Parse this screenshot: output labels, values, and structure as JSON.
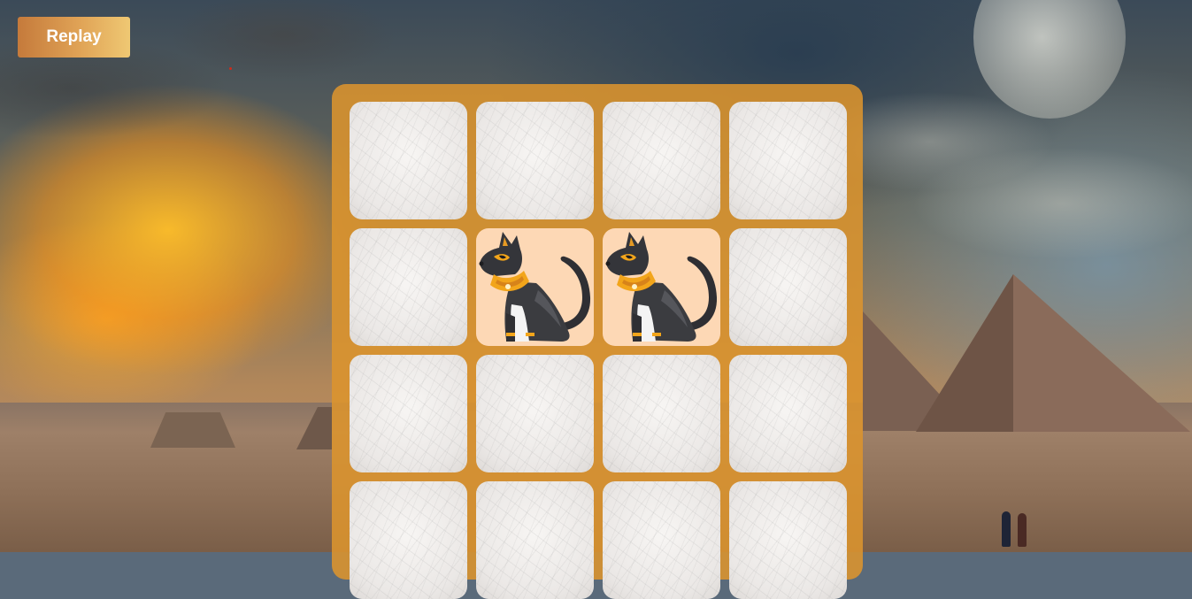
{
  "header": {
    "replay_label": "Replay"
  },
  "board": {
    "cards": [
      {
        "state": "face-down"
      },
      {
        "state": "face-down"
      },
      {
        "state": "face-down"
      },
      {
        "state": "face-down"
      },
      {
        "state": "face-down"
      },
      {
        "state": "face-up",
        "icon": "bastet-cat-icon"
      },
      {
        "state": "face-up",
        "icon": "bastet-cat-icon"
      },
      {
        "state": "face-down"
      },
      {
        "state": "face-down"
      },
      {
        "state": "face-down"
      },
      {
        "state": "face-down"
      },
      {
        "state": "face-down"
      },
      {
        "state": "face-down"
      },
      {
        "state": "face-down"
      },
      {
        "state": "face-down"
      },
      {
        "state": "face-down"
      }
    ]
  },
  "colors": {
    "board": "#dc942d",
    "button_gradient": [
      "#c57a3b",
      "#efc873"
    ],
    "card_front": "#fdd8b5",
    "card_back": "#ebe8e6"
  }
}
